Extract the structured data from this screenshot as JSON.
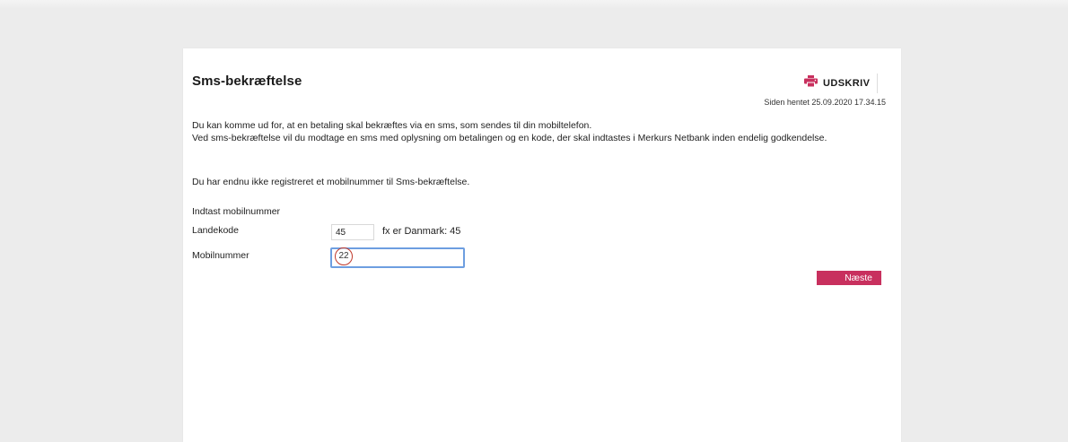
{
  "page": {
    "title": "Sms-bekræftelse",
    "print_label": "UDSKRIV",
    "fetched": "Siden hentet 25.09.2020 17.34.15"
  },
  "intro": {
    "line1": "Du kan komme ud for, at en betaling skal bekræftes via en sms, som sendes til din mobiltelefon.",
    "line2": "Ved sms-bekræftelse vil du modtage en sms med oplysning om betalingen og en kode, der skal indtastes i Merkurs Netbank inden endelig godkendelse."
  },
  "notice": "Du har endnu ikke registreret et mobilnummer til Sms-bekræftelse.",
  "form": {
    "section_label": "Indtast mobilnummer",
    "country_label": "Landekode",
    "country_value": "45",
    "country_hint": "fx er Danmark: 45",
    "mobile_label": "Mobilnummer",
    "mobile_value": "",
    "marker": "22",
    "next_label": "Næste"
  },
  "colors": {
    "accent": "#c8305e",
    "focus": "#6d9ee0",
    "background": "#ececec"
  },
  "icons": {
    "print": "printer-icon"
  }
}
